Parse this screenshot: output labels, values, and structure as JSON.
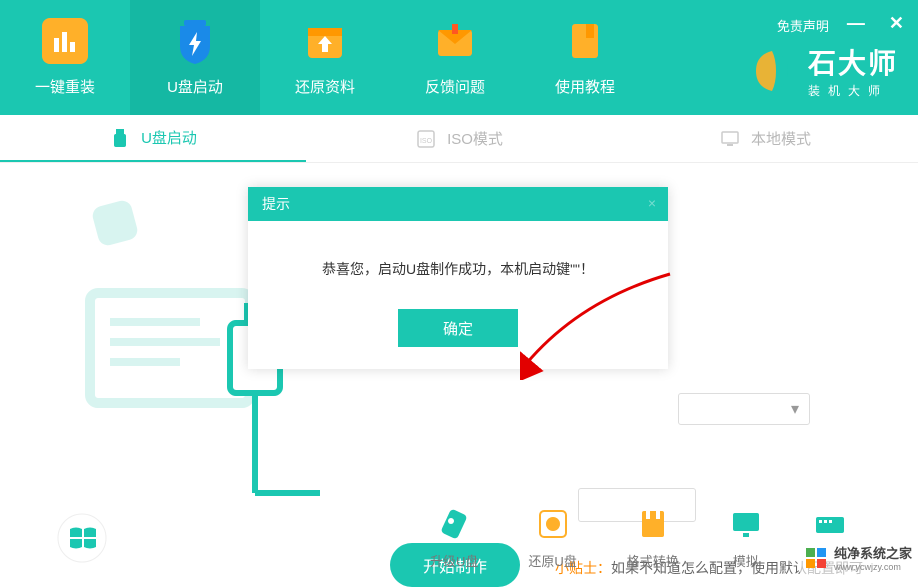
{
  "header": {
    "disclaimer": "免责声明",
    "logo_main": "石大师",
    "logo_sub": "装机大师"
  },
  "nav": [
    {
      "label": "一键重装"
    },
    {
      "label": "U盘启动"
    },
    {
      "label": "还原资料"
    },
    {
      "label": "反馈问题"
    },
    {
      "label": "使用教程"
    }
  ],
  "sub_tabs": [
    {
      "label": "U盘启动"
    },
    {
      "label": "ISO模式"
    },
    {
      "label": "本地模式"
    }
  ],
  "modal": {
    "title": "提示",
    "message": "恭喜您，启动U盘制作成功，本机启动键\"\"！",
    "confirm": "确定"
  },
  "main": {
    "start_btn": "开始制作",
    "tip_label": "小贴士：",
    "tip_text": "如果不知道怎么配置，使用默认配置即可"
  },
  "bottom": [
    {
      "label": "升级U盘"
    },
    {
      "label": "还原U盘"
    },
    {
      "label": "格式转换"
    },
    {
      "label": "模拟"
    }
  ],
  "watermark": {
    "name": "纯净系统之家",
    "url": "www.ycwjzy.com"
  }
}
